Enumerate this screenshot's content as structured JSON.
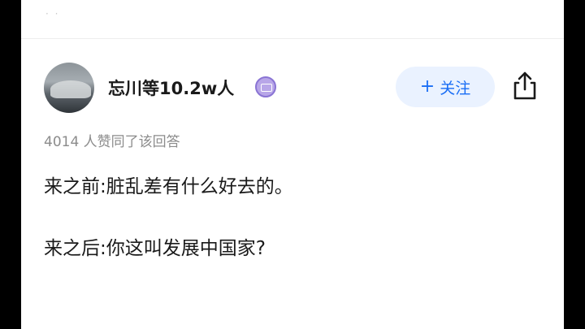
{
  "header": {
    "top_dots": "· ·"
  },
  "author": {
    "name": "忘川等10.2w人",
    "avatar": "mountain-avatar",
    "badge": "purple-badge-icon"
  },
  "actions": {
    "follow_label": "关注",
    "follow_plus": "+",
    "share_icon": "share-icon",
    "accent": "#1a6ef5",
    "follow_bg": "#eaf2ff"
  },
  "answer": {
    "agree_text": "4014 人赞同了该回答",
    "paragraphs": [
      "来之前:脏乱差有什么好去的。",
      "来之后:你这叫发展中国家?"
    ]
  }
}
